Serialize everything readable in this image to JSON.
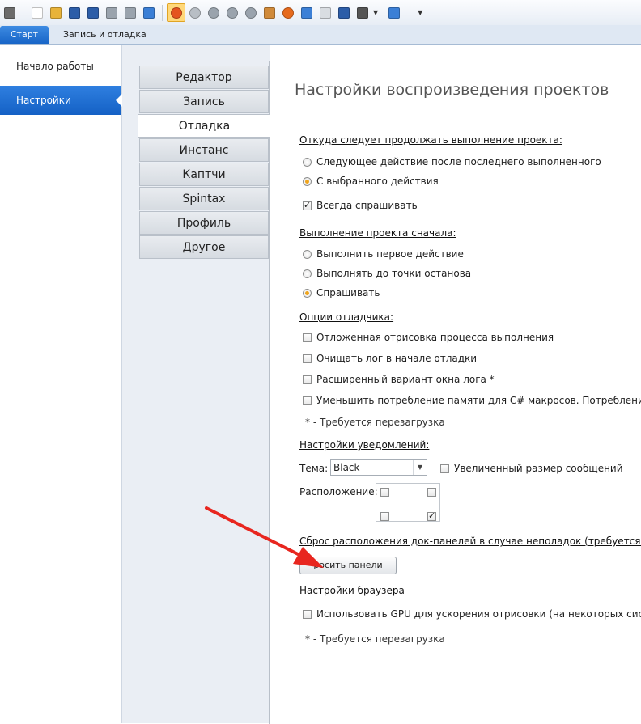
{
  "toolbar": {
    "buttons": [
      {
        "icon": "people-icon",
        "color": "#6b6b6b"
      },
      {
        "icon": "new-file-icon",
        "color": "#ffffff"
      },
      {
        "icon": "open-folder-icon",
        "color": "#e8b33a"
      },
      {
        "icon": "save-icon",
        "color": "#2c5da8"
      },
      {
        "icon": "save-all-icon",
        "color": "#2c5da8"
      },
      {
        "icon": "undo-icon",
        "color": "#9aa3ad"
      },
      {
        "icon": "redo-icon",
        "color": "#9aa3ad"
      },
      {
        "icon": "notebook-icon",
        "color": "#3b7fd6"
      },
      {
        "icon": "record-icon",
        "color": "#e4541f",
        "active": true
      },
      {
        "icon": "check-circle-icon",
        "color": "#b8bec5"
      },
      {
        "icon": "play-icon",
        "color": "#9aa3ad"
      },
      {
        "icon": "step-icon",
        "color": "#9aa3ad"
      },
      {
        "icon": "stop-icon",
        "color": "#9aa3ad"
      },
      {
        "icon": "user-icon",
        "color": "#d08a3a"
      },
      {
        "icon": "firefox-icon",
        "color": "#e66a1d"
      },
      {
        "icon": "flask-icon",
        "color": "#3b7fd6"
      },
      {
        "icon": "mail-icon",
        "color": "#d9dde2"
      },
      {
        "icon": "chart-icon",
        "color": "#2c5da8"
      },
      {
        "icon": "window-icon",
        "color": "#555555"
      },
      {
        "icon": "expand-icon",
        "color": "#3b7fd6"
      }
    ]
  },
  "ribbon": {
    "tabs": [
      "Старт",
      "Запись и отладка"
    ]
  },
  "leftnav": {
    "items": [
      "Начало работы",
      "Настройки"
    ]
  },
  "vtabs": [
    "Редактор",
    "Запись",
    "Отладка",
    "Инстанс",
    "Каптчи",
    "Spintax",
    "Профиль",
    "Другое"
  ],
  "content": {
    "title": "Настройки воспроизведения проектов",
    "s1": {
      "header": "Откуда следует продолжать выполнение проекта:",
      "opt1": "Следующее действие после последнего выполненного",
      "opt2": "С выбранного действия",
      "always_ask": "Всегда спрашивать"
    },
    "s2": {
      "header": "Выполнение проекта сначала:",
      "opt1": "Выполнить первое действие",
      "opt2": "Выполнять до точки останова",
      "opt3": "Спрашивать"
    },
    "s3": {
      "header": "Опции отладчика:",
      "c1": "Отложенная отрисовка процесса выполнения",
      "c2": "Очищать лог в начале отладки",
      "c3": "Расширенный вариант окна лога *",
      "c4": "Уменьшить потребление памяти для C# макросов. Потребление CPU",
      "note": "* - Требуется перезагрузка"
    },
    "s4": {
      "header": "Настройки уведомлений:",
      "theme_label": "Тема:",
      "theme_value": "Black",
      "bigger": "Увеличенный размер сообщений",
      "position_label": "Расположение:"
    },
    "s5": {
      "header": "Сброс расположения док-панелей в случае неполадок (требуется пере",
      "button": "росить панели"
    },
    "s6": {
      "header": "Настройки браузера",
      "gpu": "Использовать GPU для ускорения отрисовки (на некоторых системах",
      "note": "* - Требуется перезагрузка"
    }
  },
  "colors": {
    "accent": "#1a6bd0",
    "arrow": "#e8261f",
    "radio_selected": "#f0a51c"
  }
}
